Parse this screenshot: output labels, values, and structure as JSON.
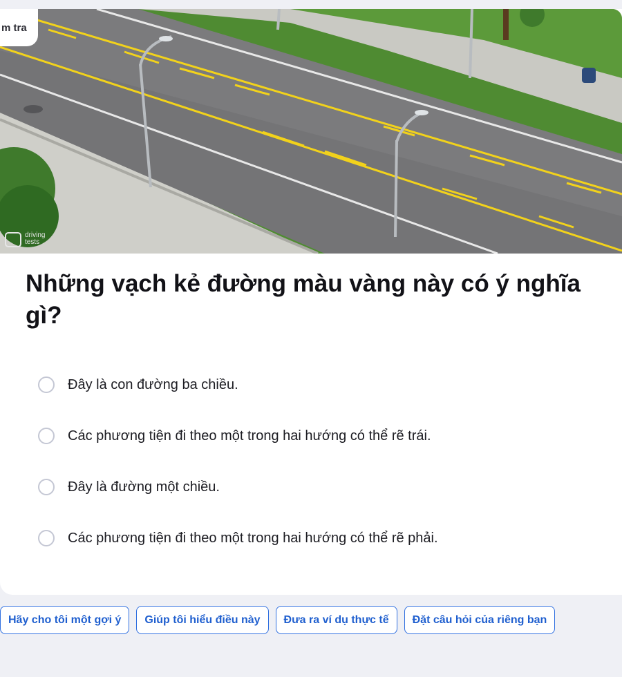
{
  "header": {
    "tag_label": "m tra"
  },
  "hero": {
    "watermark": "driving tests"
  },
  "question": {
    "text": "Những vạch kẻ đường màu vàng này có ý nghĩa gì?"
  },
  "options": [
    {
      "label": "Đây là con đường ba chiều."
    },
    {
      "label": "Các phương tiện đi theo một trong hai hướng có thể rẽ trái."
    },
    {
      "label": "Đây là đường một chiều."
    },
    {
      "label": "Các phương tiện đi theo một trong hai hướng có thể rẽ phải."
    }
  ],
  "chips": [
    {
      "label": "Hãy cho tôi một gợi ý"
    },
    {
      "label": "Giúp tôi hiểu điều này"
    },
    {
      "label": "Đưa ra ví dụ thực tế"
    },
    {
      "label": "Đặt câu hỏi của riêng bạn"
    }
  ],
  "colors": {
    "accent": "#2f6fe0",
    "lane_yellow": "#f2d21b",
    "asphalt": "#7b7b7d"
  }
}
